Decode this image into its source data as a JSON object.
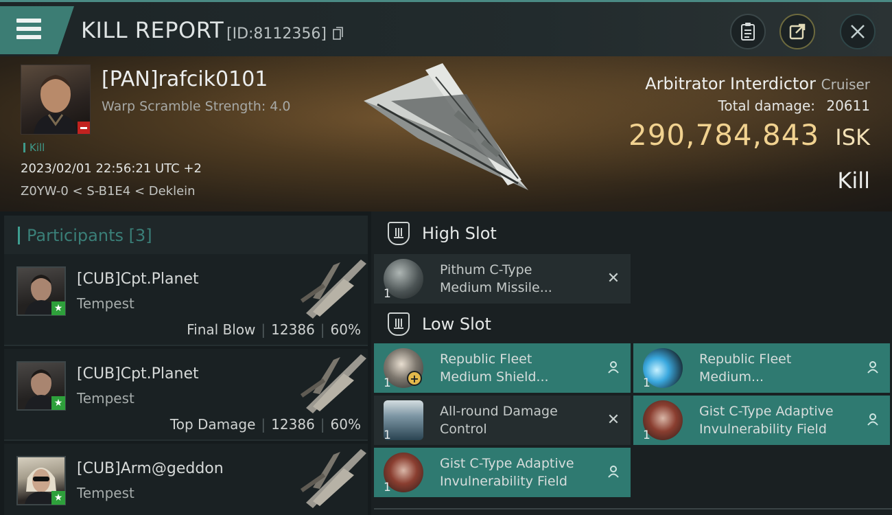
{
  "header": {
    "title": "KILL REPORT",
    "report_id": "[ID:8112356]"
  },
  "victim": {
    "pilot_name": "[PAN]rafcik0101",
    "warp_text": "Warp Scramble Strength: 4.0",
    "kill_tag": "Kill",
    "timestamp": "2023/02/01 22:56:21 UTC +2",
    "location": "Z0YW-0 < S-B1E4 < Deklein",
    "ship_name": "Arbitrator Interdictor",
    "ship_class": "Cruiser",
    "total_damage_label": "Total damage:",
    "total_damage": "20611",
    "isk_value": "290,784,843",
    "isk_unit": "ISK",
    "result": "Kill"
  },
  "participants": {
    "title": "Participants [3]",
    "rows": [
      {
        "name": "[CUB]Cpt.Planet",
        "ship": "Tempest",
        "role": "Final Blow",
        "damage": "12386",
        "percent": "60%"
      },
      {
        "name": "[CUB]Cpt.Planet",
        "ship": "Tempest",
        "role": "Top Damage",
        "damage": "12386",
        "percent": "60%"
      },
      {
        "name": "[CUB]Arm@geddon",
        "ship": "Tempest",
        "role": "",
        "damage": "",
        "percent": ""
      }
    ]
  },
  "fitting": {
    "high_slot": {
      "title": "High Slot",
      "modules": [
        {
          "name_line1": "Pithum C-Type",
          "name_line2": "Medium Missile...",
          "qty": "1",
          "state": "destroyed"
        }
      ]
    },
    "low_slot": {
      "title": "Low Slot",
      "modules": [
        {
          "name_line1": "Republic Fleet",
          "name_line2": "Medium Shield...",
          "qty": "1",
          "state": "dropped"
        },
        {
          "name_line1": "Republic Fleet",
          "name_line2": "Medium...",
          "qty": "1",
          "state": "dropped"
        },
        {
          "name_line1": "All-round Damage",
          "name_line2": "Control",
          "qty": "1",
          "state": "destroyed"
        },
        {
          "name_line1": "Gist C-Type Adaptive",
          "name_line2": "Invulnerability Field",
          "qty": "1",
          "state": "dropped"
        },
        {
          "name_line1": "Gist C-Type Adaptive",
          "name_line2": "Invulnerability Field",
          "qty": "1",
          "state": "dropped"
        }
      ]
    }
  },
  "colors": {
    "accent": "#3c7d74",
    "dropped_bg": "#2f7a71",
    "isk": "#f1d290",
    "badge_red": "#c2221f",
    "badge_green": "#2ea03b"
  },
  "icons": {
    "menu": "hamburger-icon",
    "copy": "copy-icon",
    "clipboard": "clipboard-icon",
    "share": "share-icon",
    "close": "close-icon"
  }
}
